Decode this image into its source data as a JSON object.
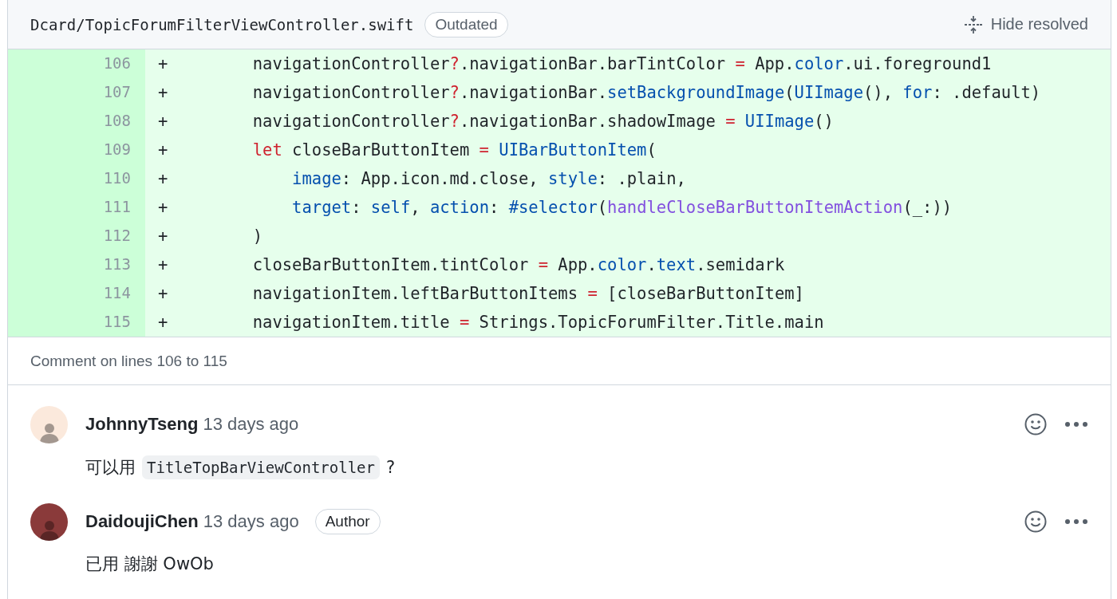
{
  "file_header": {
    "path": "Dcard/TopicForumFilterViewController.swift",
    "badge": "Outdated",
    "action": "Hide resolved"
  },
  "diff_lines": [
    {
      "number": "106",
      "marker": "+",
      "tokens": [
        {
          "text": "        navigationController",
          "kind": "plain"
        },
        {
          "text": "?",
          "kind": "keyword"
        },
        {
          "text": ".navigationBar.barTintColor ",
          "kind": "plain"
        },
        {
          "text": "=",
          "kind": "keyword"
        },
        {
          "text": " App.",
          "kind": "plain"
        },
        {
          "text": "color",
          "kind": "entity"
        },
        {
          "text": ".ui.foreground1",
          "kind": "plain"
        }
      ]
    },
    {
      "number": "107",
      "marker": "+",
      "tokens": [
        {
          "text": "        navigationController",
          "kind": "plain"
        },
        {
          "text": "?",
          "kind": "keyword"
        },
        {
          "text": ".navigationBar.",
          "kind": "plain"
        },
        {
          "text": "setBackgroundImage",
          "kind": "entity"
        },
        {
          "text": "(",
          "kind": "plain"
        },
        {
          "text": "UIImage",
          "kind": "entity"
        },
        {
          "text": "(), ",
          "kind": "plain"
        },
        {
          "text": "for",
          "kind": "entity"
        },
        {
          "text": ": .default)",
          "kind": "plain"
        }
      ]
    },
    {
      "number": "108",
      "marker": "+",
      "tokens": [
        {
          "text": "        navigationController",
          "kind": "plain"
        },
        {
          "text": "?",
          "kind": "keyword"
        },
        {
          "text": ".navigationBar.shadowImage ",
          "kind": "plain"
        },
        {
          "text": "=",
          "kind": "keyword"
        },
        {
          "text": " UIImage",
          "kind": "entity"
        },
        {
          "text": "()",
          "kind": "plain"
        }
      ]
    },
    {
      "number": "109",
      "marker": "+",
      "tokens": [
        {
          "text": "        let",
          "kind": "keyword"
        },
        {
          "text": " closeBarButtonItem ",
          "kind": "plain"
        },
        {
          "text": "=",
          "kind": "keyword"
        },
        {
          "text": " UIBarButtonItem",
          "kind": "entity"
        },
        {
          "text": "(",
          "kind": "plain"
        }
      ]
    },
    {
      "number": "110",
      "marker": "+",
      "tokens": [
        {
          "text": "            image",
          "kind": "entity"
        },
        {
          "text": ": App.icon.md.close, ",
          "kind": "plain"
        },
        {
          "text": "style",
          "kind": "entity"
        },
        {
          "text": ": .plain,",
          "kind": "plain"
        }
      ]
    },
    {
      "number": "111",
      "marker": "+",
      "tokens": [
        {
          "text": "            target",
          "kind": "entity"
        },
        {
          "text": ": ",
          "kind": "plain"
        },
        {
          "text": "self",
          "kind": "entity"
        },
        {
          "text": ", ",
          "kind": "plain"
        },
        {
          "text": "action",
          "kind": "entity"
        },
        {
          "text": ": ",
          "kind": "plain"
        },
        {
          "text": "#selector",
          "kind": "entity"
        },
        {
          "text": "(",
          "kind": "plain"
        },
        {
          "text": "handleCloseBarButtonItemAction",
          "kind": "function"
        },
        {
          "text": "(_:))",
          "kind": "plain"
        }
      ]
    },
    {
      "number": "112",
      "marker": "+",
      "tokens": [
        {
          "text": "        )",
          "kind": "plain"
        }
      ]
    },
    {
      "number": "113",
      "marker": "+",
      "tokens": [
        {
          "text": "        closeBarButtonItem.tintColor ",
          "kind": "plain"
        },
        {
          "text": "=",
          "kind": "keyword"
        },
        {
          "text": " App.",
          "kind": "plain"
        },
        {
          "text": "color",
          "kind": "entity"
        },
        {
          "text": ".",
          "kind": "plain"
        },
        {
          "text": "text",
          "kind": "entity"
        },
        {
          "text": ".semidark",
          "kind": "plain"
        }
      ]
    },
    {
      "number": "114",
      "marker": "+",
      "tokens": [
        {
          "text": "        navigationItem.leftBarButtonItems ",
          "kind": "plain"
        },
        {
          "text": "=",
          "kind": "keyword"
        },
        {
          "text": " [closeBarButtonItem]",
          "kind": "plain"
        }
      ]
    },
    {
      "number": "115",
      "marker": "+",
      "tokens": [
        {
          "text": "        navigationItem.title ",
          "kind": "plain"
        },
        {
          "text": "=",
          "kind": "keyword"
        },
        {
          "text": " Strings.TopicForumFilter.Title.main",
          "kind": "plain"
        }
      ]
    }
  ],
  "comment_range": "Comment on lines 106 to 115",
  "comments": [
    {
      "author": "JohnnyTseng",
      "time": "13 days ago",
      "body": [
        {
          "text": "可以用",
          "kind": "text"
        },
        {
          "text": "TitleTopBarViewController",
          "kind": "code"
        },
        {
          "text": "?",
          "kind": "text"
        }
      ]
    },
    {
      "author": "DaidoujiChen",
      "time": "13 days ago",
      "badge": "Author",
      "body": [
        {
          "text": "已用 謝謝 OwOb",
          "kind": "text"
        }
      ]
    }
  ]
}
